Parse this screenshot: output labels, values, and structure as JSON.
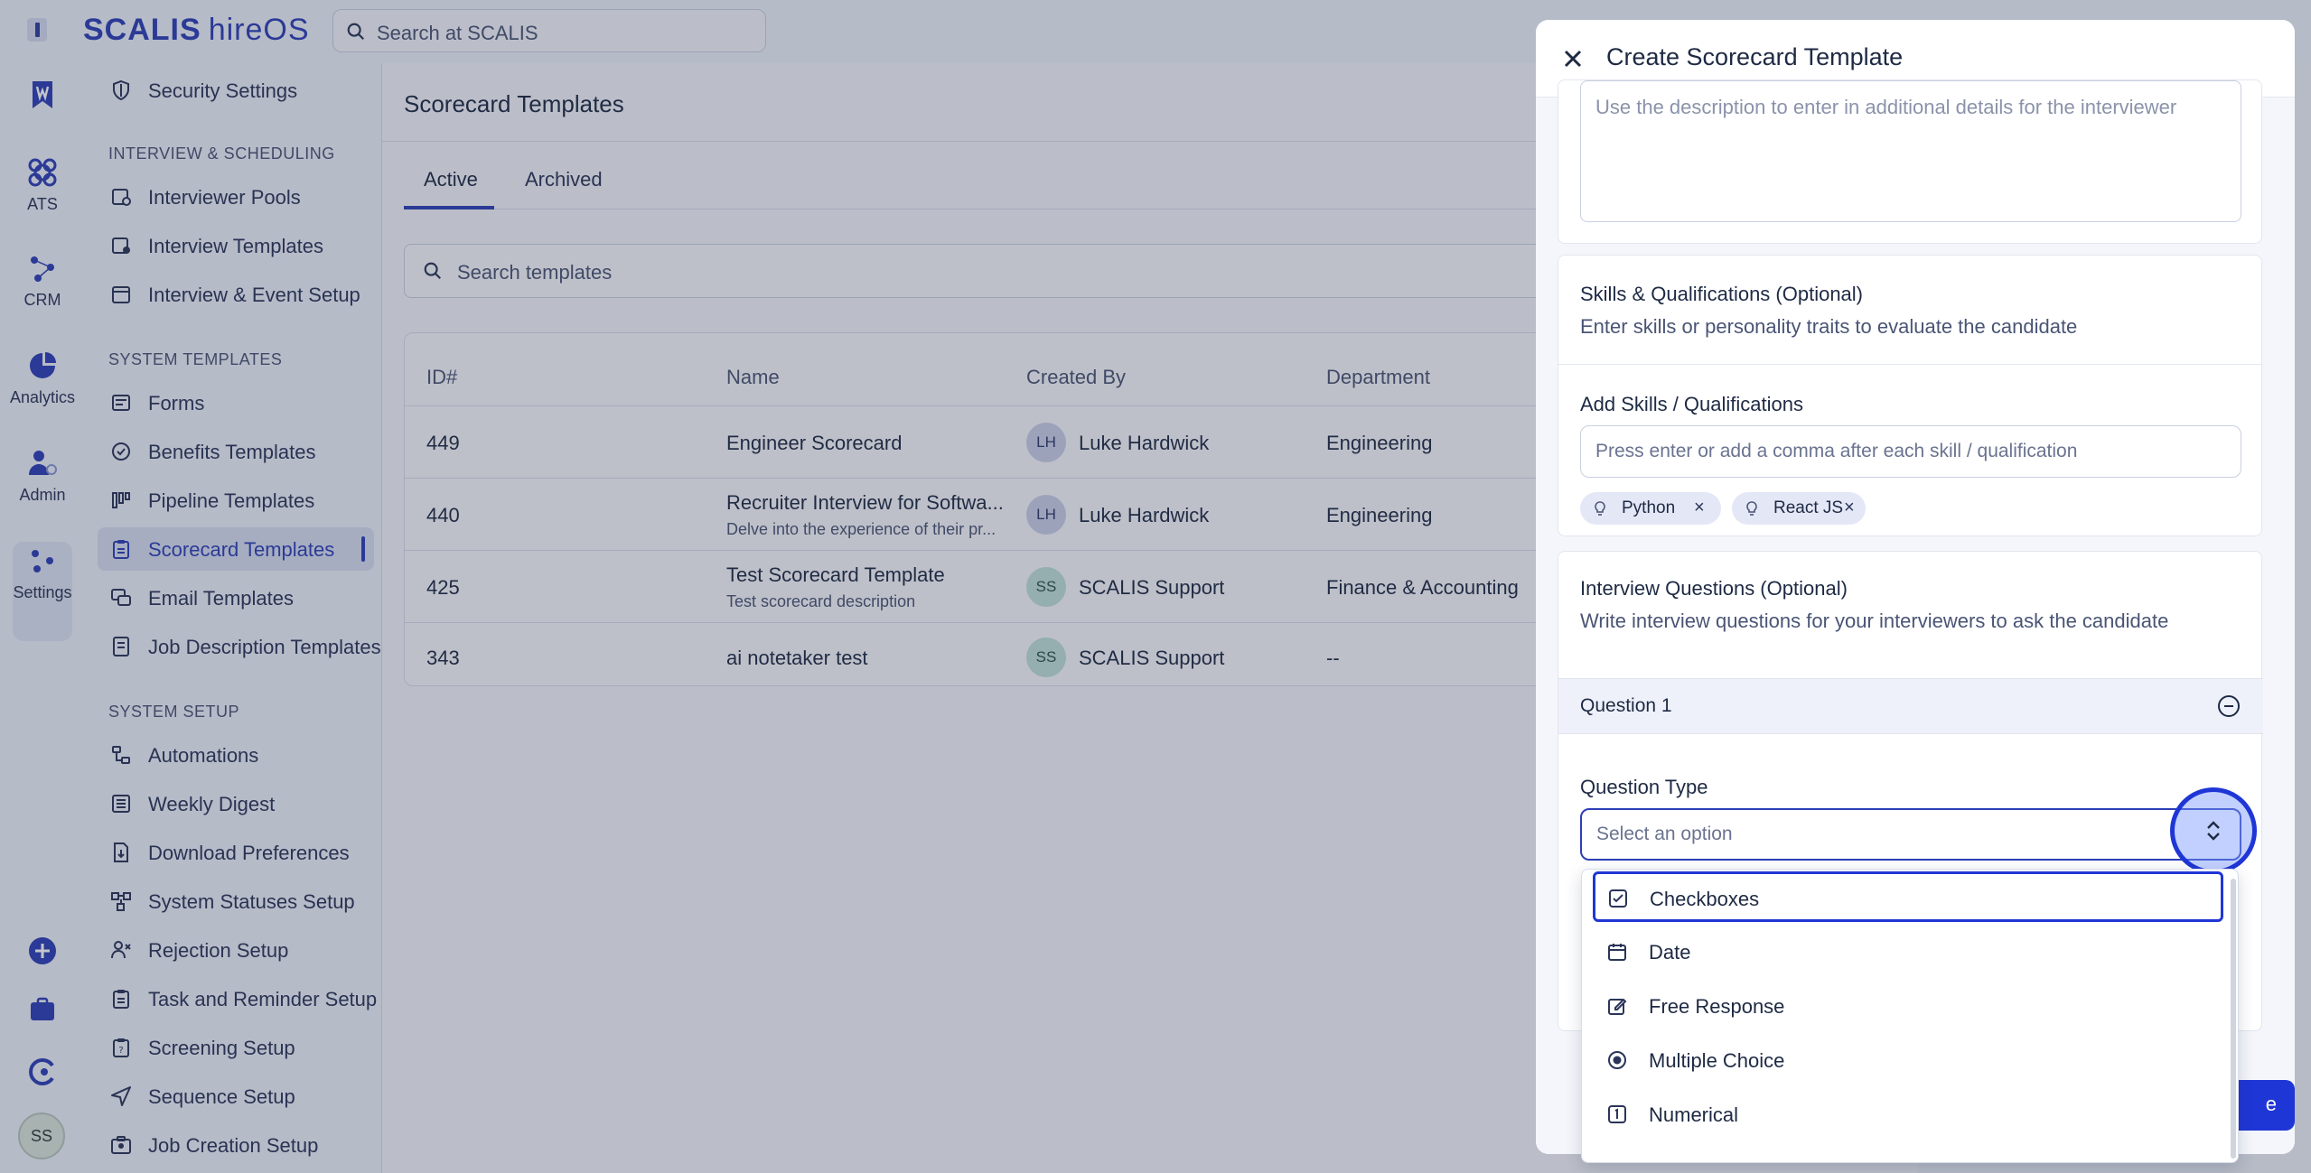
{
  "brand": {
    "name": "SCALIS",
    "product": "hireOS"
  },
  "top_search": {
    "placeholder": "Search at SCALIS"
  },
  "rail": [
    {
      "label": ""
    },
    {
      "label": "ATS"
    },
    {
      "label": "CRM"
    },
    {
      "label": "Analytics"
    },
    {
      "label": "Admin"
    },
    {
      "label": "Settings"
    }
  ],
  "user": {
    "initials": "SS"
  },
  "nav": {
    "top_item": "Security Settings",
    "sections": {
      "interview": "INTERVIEW & SCHEDULING",
      "templates": "SYSTEM TEMPLATES",
      "setup": "SYSTEM SETUP"
    },
    "interview_items": [
      "Interviewer Pools",
      "Interview Templates",
      "Interview & Event Setup"
    ],
    "template_items": [
      "Forms",
      "Benefits Templates",
      "Pipeline Templates",
      "Scorecard Templates",
      "Email Templates",
      "Job Description Templates"
    ],
    "setup_items": [
      "Automations",
      "Weekly Digest",
      "Download Preferences",
      "System Statuses Setup",
      "Rejection Setup",
      "Task and Reminder Setup",
      "Screening Setup",
      "Sequence Setup",
      "Job Creation Setup"
    ]
  },
  "main": {
    "title": "Scorecard Templates",
    "tabs": [
      "Active",
      "Archived"
    ],
    "search_placeholder": "Search templates",
    "columns": [
      "ID#",
      "Name",
      "Created By",
      "Department"
    ],
    "rows": [
      {
        "id": "449",
        "name": "Engineer Scorecard",
        "desc": "",
        "initials": "LH",
        "creator": "Luke Hardwick",
        "dept": "Engineering"
      },
      {
        "id": "440",
        "name": "Recruiter Interview for Softwa...",
        "desc": "Delve into the experience of their pr...",
        "initials": "LH",
        "creator": "Luke Hardwick",
        "dept": "Engineering"
      },
      {
        "id": "425",
        "name": "Test Scorecard Template",
        "desc": "Test scorecard description",
        "initials": "SS",
        "creator": "SCALIS Support",
        "dept": "Finance & Accounting"
      },
      {
        "id": "343",
        "name": "ai notetaker test",
        "desc": "",
        "initials": "SS",
        "creator": "SCALIS Support",
        "dept": "--"
      }
    ]
  },
  "drawer": {
    "title": "Create Scorecard Template",
    "description_placeholder": "Use the description to enter in additional details for the interviewer",
    "skills": {
      "title": "Skills & Qualifications (Optional)",
      "hint": "Enter skills or personality traits to evaluate the candidate",
      "add_label": "Add Skills / Qualifications",
      "placeholder": "Press enter or add a comma after each skill / qualification",
      "chips": [
        "Python",
        "React JS"
      ]
    },
    "questions": {
      "title": "Interview Questions (Optional)",
      "hint": "Write interview questions for your interviewers to ask the candidate",
      "question_label": "Question 1",
      "type_label": "Question Type",
      "type_placeholder": "Select an option",
      "options": [
        "Checkboxes",
        "Date",
        "Free Response",
        "Multiple Choice",
        "Numerical"
      ]
    },
    "save_button_partial": "e"
  }
}
